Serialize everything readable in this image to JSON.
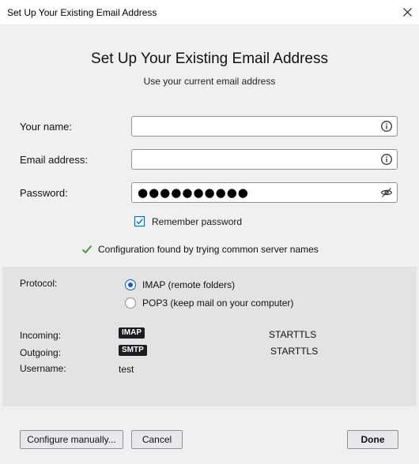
{
  "window": {
    "title": "Set Up Your Existing Email Address"
  },
  "header": {
    "title": "Set Up Your Existing Email Address",
    "subtitle": "Use your current email address"
  },
  "form": {
    "name_label": "Your name:",
    "name_value": "",
    "email_label": "Email address:",
    "email_value": "",
    "password_label": "Password:",
    "password_masked": "●●●●●●●●●●",
    "remember_label": "Remember password",
    "remember_checked": true
  },
  "status": {
    "message": "Configuration found by trying common server names",
    "color": "#2a9d2a"
  },
  "config": {
    "protocol_label": "Protocol:",
    "protocol_options": [
      "IMAP (remote folders)",
      "POP3 (keep mail on your computer)"
    ],
    "selected_protocol": "IMAP (remote folders)",
    "incoming_label": "Incoming:",
    "incoming_type": "IMAP",
    "incoming_security": "STARTTLS",
    "outgoing_label": "Outgoing:",
    "outgoing_type": "SMTP",
    "outgoing_security": "STARTTLS",
    "username_label": "Username:",
    "username_value": "test"
  },
  "buttons": {
    "configure_manually": "Configure manually...",
    "cancel": "Cancel",
    "done": "Done"
  },
  "colors": {
    "accent": "#0060df",
    "badge_bg": "#1c1b22"
  },
  "icons": [
    "close-icon",
    "info-icon",
    "eye-slash-icon",
    "checkmark-icon"
  ]
}
